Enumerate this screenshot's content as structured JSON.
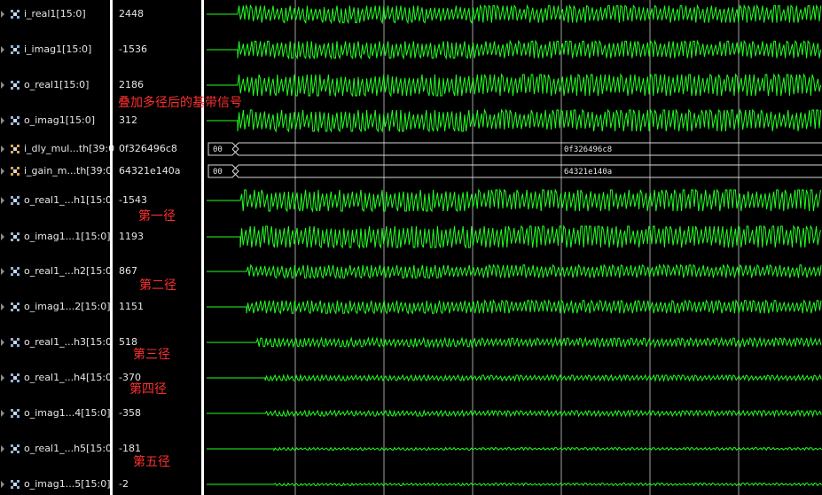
{
  "colors": {
    "background": "#000000",
    "wave": "#22ff22",
    "bus_outline": "#d9d9d9",
    "text": "#e6e6e6",
    "annotation": "#ff2f2f",
    "grid": "#bfbfbf"
  },
  "signals": [
    {
      "name": "i_real1[15:0]",
      "value": "2448",
      "icon": "bus-icon-blue",
      "kind": "analog",
      "amplitude": 0.8,
      "start": 0.05
    },
    {
      "name": "i_imag1[15:0]",
      "value": "-1536",
      "icon": "bus-icon-blue",
      "kind": "analog",
      "amplitude": 0.8,
      "start": 0.05
    },
    {
      "name": "o_real1[15:0]",
      "value": "2186",
      "icon": "bus-icon-blue",
      "kind": "analog",
      "amplitude": 1.0,
      "start": 0.05
    },
    {
      "name": "o_imag1[15:0]",
      "value": "312",
      "icon": "bus-icon-blue",
      "kind": "analog",
      "amplitude": 1.0,
      "start": 0.05
    },
    {
      "name": "i_dly_mul...th[39:0",
      "value": "0f326496c8",
      "icon": "bus-icon-orange",
      "kind": "bus",
      "bus_before": "00",
      "bus_after": "0f326496c8"
    },
    {
      "name": "i_gain_m...th[39:0",
      "value": "64321e140a",
      "icon": "bus-icon-orange",
      "kind": "bus",
      "bus_before": "00",
      "bus_after": "64321e140a"
    },
    {
      "name": "o_real1_...h1[15:0",
      "value": "-1543",
      "icon": "bus-icon-blue",
      "kind": "analog",
      "amplitude": 1.0,
      "start": 0.055
    },
    {
      "name": "o_imag1...1[15:0]",
      "value": "1193",
      "icon": "bus-icon-blue",
      "kind": "analog",
      "amplitude": 1.0,
      "start": 0.055
    },
    {
      "name": "o_real1_...h2[15:0",
      "value": "867",
      "icon": "bus-icon-blue",
      "kind": "analog",
      "amplitude": 0.6,
      "start": 0.065
    },
    {
      "name": "o_imag1...2[15:0]",
      "value": "1151",
      "icon": "bus-icon-blue",
      "kind": "analog",
      "amplitude": 0.6,
      "start": 0.065
    },
    {
      "name": "o_real1_...h3[15:0",
      "value": "518",
      "icon": "bus-icon-blue",
      "kind": "analog",
      "amplitude": 0.4,
      "start": 0.08
    },
    {
      "name": "o_real1_...h4[15:0",
      "value": "-370",
      "icon": "bus-icon-blue",
      "kind": "analog",
      "amplitude": 0.25,
      "start": 0.095
    },
    {
      "name": "o_imag1...4[15:0]",
      "value": "-358",
      "icon": "bus-icon-blue",
      "kind": "analog",
      "amplitude": 0.25,
      "start": 0.095
    },
    {
      "name": "o_real1_...h5[15:0",
      "value": "-181",
      "icon": "bus-icon-blue",
      "kind": "analog",
      "amplitude": 0.12,
      "start": 0.11
    },
    {
      "name": "o_imag1...5[15:0]",
      "value": "-2",
      "icon": "bus-icon-blue",
      "kind": "analog",
      "amplitude": 0.12,
      "start": 0.11
    }
  ],
  "annotations": {
    "sum": "叠加多径后的基带信号",
    "path1": "第一径",
    "path2": "第二径",
    "path3": "第三径",
    "path4": "第四径",
    "path5": "第五径"
  }
}
